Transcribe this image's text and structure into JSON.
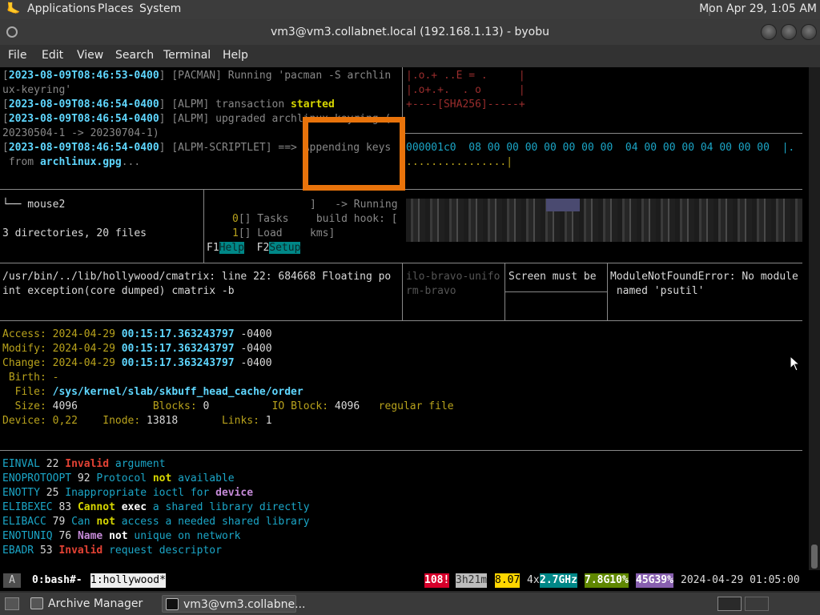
{
  "topbar": {
    "menus": [
      "Applications",
      "Places",
      "System"
    ],
    "clock": "Mon Apr 29,  1:05 AM"
  },
  "window": {
    "title": "vm3@vm3.collabnet.local (192.168.1.13) - byobu"
  },
  "menubar": [
    "File",
    "Edit",
    "View",
    "Search",
    "Terminal",
    "Help"
  ],
  "pane1": {
    "l1": [
      "[",
      "2023-08-09T08:46:53-0400",
      "] [PACMAN] Running 'pacman -S archlin"
    ],
    "l2": "ux-keyring'",
    "l3": [
      "[",
      "2023-08-09T08:46:54-0400",
      "] [ALPM] transaction ",
      "started"
    ],
    "l4": [
      "[",
      "2023-08-09T08:46:54-0400",
      "] [ALPM] upgraded archlinux-keyring ("
    ],
    "l5": "20230504-1 -> 20230704-1)",
    "l6": [
      "[",
      "2023-08-09T08:46:54-0400",
      "] [ALPM-SCRIPTLET] ==> Appending keys"
    ],
    "l7": [
      " from ",
      "archlinux.gpg",
      "..."
    ]
  },
  "pane2": {
    "l1": "|.o.+ ..E = .     |",
    "l2": "|.o+.+.  . o      |",
    "l3": "+----[SHA256]-----+"
  },
  "pane3": {
    "hex": "000001c0  08 00 00 00 00 00 00 00  04 00 00 00 04 00 00 00  |.",
    "dots": "................|"
  },
  "tree": {
    "item": "└── mouse2",
    "summary": "3 directories, 20 files"
  },
  "menu_pane": {
    "tasks_num": "0",
    "tasks": "[] Tasks",
    "load_num": "1",
    "load": "[] Load",
    "f1": "F1",
    "f1_label": "Help",
    "f2": "F2",
    "f2_label": "Setup"
  },
  "popup": {
    "l1": "]   -> Running",
    "l2": " build hook: [",
    "l3": "kms]"
  },
  "cmatrix": {
    "l1": "/usr/bin/../lib/hollywood/cmatrix: line 22: 684668 Floating po",
    "l2": "int exception(core dumped) cmatrix -b"
  },
  "pane_bravo": {
    "l1": "ilo-bravo-unifo",
    "l2": "rm-bravo"
  },
  "pane_screen": {
    "l1": "Screen must be"
  },
  "pane_error": {
    "l1": "ModuleNotFoundError: No module",
    "l2": " named 'psutil'"
  },
  "stat": {
    "access_label": "Access:",
    "access_date": "2024-04-29",
    "access_time": "00:15:17.363243797",
    "access_tz": "-0400",
    "modify_label": "Modify:",
    "modify_date": "2024-04-29",
    "modify_time": "00:15:17.363243797",
    "modify_tz": "-0400",
    "change_label": "Change:",
    "change_date": "2024-04-29",
    "change_time": "00:15:17.363243797",
    "change_tz": "-0400",
    "birth_label": " Birth:",
    "birth_val": "-",
    "file_label": "  File:",
    "file_val": "/sys/kernel/slab/skbuff_head_cache/order",
    "size_label": "  Size:",
    "size_val": "4096",
    "blocks_label": "Blocks:",
    "blocks_val": "0",
    "ioblock_label": "IO Block:",
    "ioblock_val": "4096",
    "filetype": "regular file",
    "device_label": "Device:",
    "device_val": "0,22",
    "inode_label": "Inode:",
    "inode_val": "13818",
    "links_label": "Links:",
    "links_val": "1"
  },
  "errno": [
    {
      "name": "EINVAL",
      "num": "22",
      "w1": "Invalid",
      "w2": "argument"
    },
    {
      "name": "ENOPROTOOPT",
      "num": "92",
      "w1": "Protocol",
      "w2": "not",
      "w3": "available"
    },
    {
      "name": "ENOTTY",
      "num": "25",
      "w1": "Inappropriate ioctl for",
      "w2": "device"
    },
    {
      "name": "ELIBEXEC",
      "num": "83",
      "w1": "Cannot",
      "w2": "exec",
      "w3": "a shared library directly"
    },
    {
      "name": "ELIBACC",
      "num": "79",
      "w1": "Can",
      "w2": "not",
      "w3": "access a needed shared library"
    },
    {
      "name": "ENOTUNIQ",
      "num": "76",
      "w1": "Name",
      "w2": "not",
      "w3": "unique on network"
    },
    {
      "name": "EBADR",
      "num": "53",
      "w1": "Invalid",
      "w2": "request descriptor"
    }
  ],
  "status": {
    "mode": "A",
    "win0": "0:bash#-",
    "win1": "1:hollywood*",
    "updates": "108!",
    "uptime": "3h21m",
    "load": "8.07",
    "cpu_count": "4x",
    "cpu_freq": "2.7GHz",
    "mem": "7.8G10%",
    "disk": "45G39%",
    "datetime": "2024-04-29 01:05:00"
  },
  "taskbar": {
    "archive": "Archive Manager",
    "terminal": "vm3@vm3.collabne..."
  },
  "colors": {
    "accent_orange": "#e8730b",
    "status_red": "#d7002a",
    "status_yellow": "#ffd700",
    "status_teal": "#008787",
    "status_green": "#5f8700",
    "status_purple": "#875faf"
  }
}
